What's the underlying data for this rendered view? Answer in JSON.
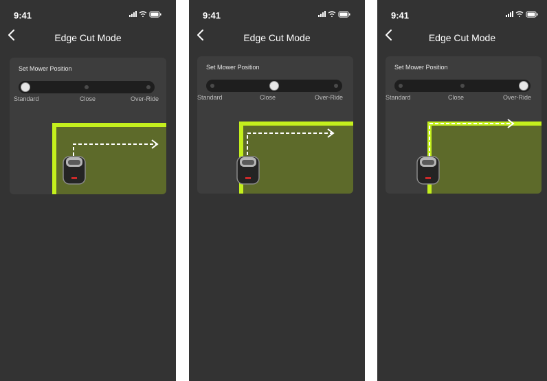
{
  "status_time": "9:41",
  "nav_title": "Edge Cut Mode",
  "position_label": "Set Mower Position",
  "options": [
    "Standard",
    "Close",
    "Over-Ride"
  ],
  "screens": [
    {
      "selected": "Standard"
    },
    {
      "selected": "Close"
    },
    {
      "selected": "Over-Ride"
    }
  ],
  "icons": [
    "back-chevron-icon",
    "signal-icon",
    "wifi-icon",
    "battery-icon",
    "mower-icon",
    "arrow-right-icon"
  ],
  "colors": {
    "background": "#333333",
    "card": "#3d3d3d",
    "edge": "#c4f01d",
    "lawn": "#5d6a2a",
    "track": "#1e1e1e"
  }
}
